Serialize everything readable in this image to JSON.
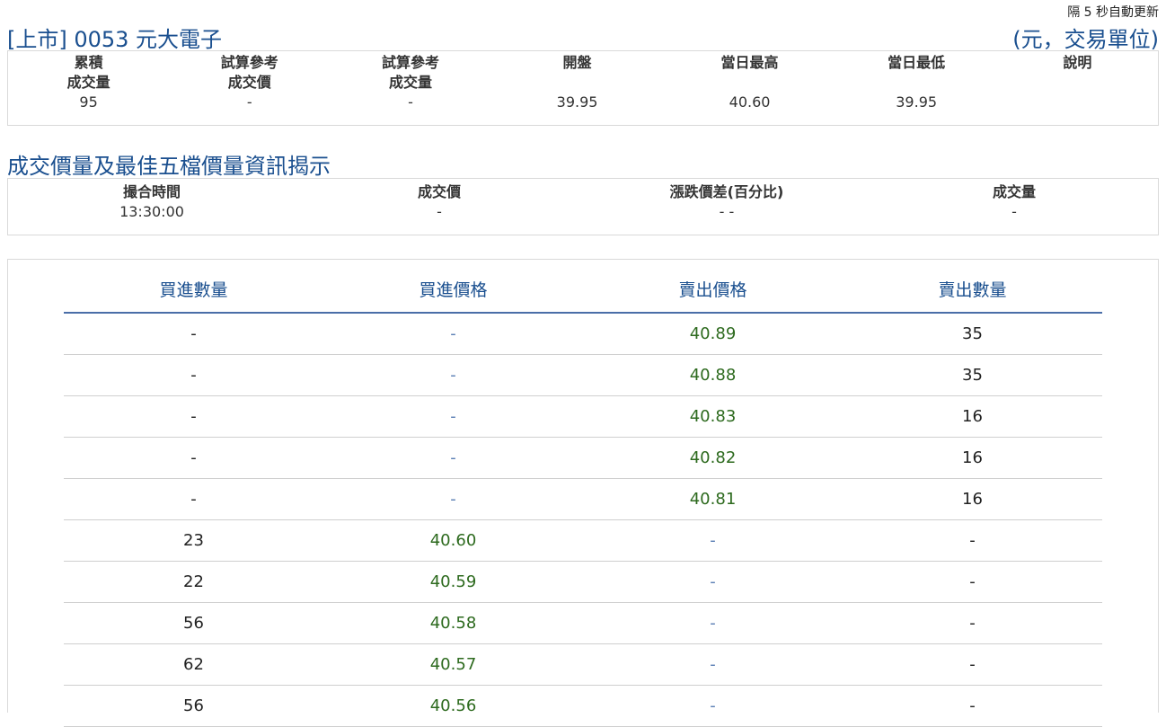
{
  "header": {
    "refresh_note": "隔 5 秒自動更新",
    "title": "[上市] 0053 元大電子",
    "unit_note": "(元，交易單位)"
  },
  "summary": {
    "columns": [
      {
        "line1": "累積",
        "line2": "成交量"
      },
      {
        "line1": "試算參考",
        "line2": "成交價"
      },
      {
        "line1": "試算參考",
        "line2": "成交量"
      },
      {
        "line1": "開盤",
        "line2": ""
      },
      {
        "line1": "當日最高",
        "line2": ""
      },
      {
        "line1": "當日最低",
        "line2": ""
      },
      {
        "line1": "說明",
        "line2": ""
      }
    ],
    "values": [
      "95",
      "-",
      "-",
      "39.95",
      "40.60",
      "39.95",
      ""
    ]
  },
  "trade_section": {
    "title": "成交價量及最佳五檔價量資訊揭示",
    "columns": [
      "撮合時間",
      "成交價",
      "漲跌價差(百分比)",
      "成交量"
    ],
    "values": [
      "13:30:00",
      "-",
      "- -",
      "-"
    ]
  },
  "order_book": {
    "columns": [
      "買進數量",
      "買進價格",
      "賣出價格",
      "賣出數量"
    ],
    "rows": [
      {
        "bid_qty": "-",
        "bid_price": "-",
        "ask_price": "40.89",
        "ask_qty": "35"
      },
      {
        "bid_qty": "-",
        "bid_price": "-",
        "ask_price": "40.88",
        "ask_qty": "35"
      },
      {
        "bid_qty": "-",
        "bid_price": "-",
        "ask_price": "40.83",
        "ask_qty": "16"
      },
      {
        "bid_qty": "-",
        "bid_price": "-",
        "ask_price": "40.82",
        "ask_qty": "16"
      },
      {
        "bid_qty": "-",
        "bid_price": "-",
        "ask_price": "40.81",
        "ask_qty": "16"
      },
      {
        "bid_qty": "23",
        "bid_price": "40.60",
        "ask_price": "-",
        "ask_qty": "-"
      },
      {
        "bid_qty": "22",
        "bid_price": "40.59",
        "ask_price": "-",
        "ask_qty": "-"
      },
      {
        "bid_qty": "56",
        "bid_price": "40.58",
        "ask_price": "-",
        "ask_qty": "-"
      },
      {
        "bid_qty": "62",
        "bid_price": "40.57",
        "ask_price": "-",
        "ask_qty": "-"
      },
      {
        "bid_qty": "56",
        "bid_price": "40.56",
        "ask_price": "-",
        "ask_qty": "-"
      }
    ]
  },
  "colors": {
    "title_blue": "#1a4f8f",
    "price_green": "#2d6a1e",
    "dash_blue": "#5b7fb5",
    "header_rule": "#4a6ea8"
  }
}
